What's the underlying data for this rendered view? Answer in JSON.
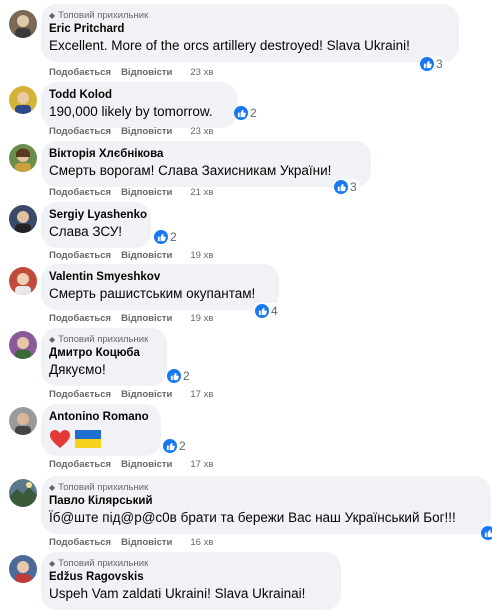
{
  "labels": {
    "top_fan": "Топовий прихильник",
    "like": "Подобається",
    "reply": "Відповісти"
  },
  "comments": [
    {
      "author": "Eric Pritchard",
      "text": "Excellent. More of the orcs artillery destroyed! Slava Ukraini!",
      "time": "23 хв",
      "reactions": "3",
      "top_fan": true,
      "avatar_color": "#7a6a55"
    },
    {
      "author": "Todd Kolod",
      "text": "190,000 likely by tomorrow.",
      "time": "23 хв",
      "reactions": "2",
      "top_fan": false,
      "avatar_color": "#d4b23a"
    },
    {
      "author": "Вікторія Хлєбнікова",
      "text": "Смерть ворогам! Слава Захисникам України!",
      "time": "21 хв",
      "reactions": "3",
      "top_fan": false,
      "avatar_color": "#6b8f4a"
    },
    {
      "author": "Sergiy Lyashenko",
      "text": "Слава ЗСУ!",
      "time": "19 хв",
      "reactions": "2",
      "top_fan": false,
      "avatar_color": "#3b4a6b"
    },
    {
      "author": "Valentin Smyeshkov",
      "text": "Смерть рашистським окупантам!",
      "time": "19 хв",
      "reactions": "4",
      "top_fan": false,
      "avatar_color": "#c24a3a"
    },
    {
      "author": "Дмитро Коцюба",
      "text": "Дякуємо!",
      "time": "17 хв",
      "reactions": "2",
      "top_fan": true,
      "avatar_color": "#8a5a9a"
    },
    {
      "author": "Antonino Romano",
      "text": "",
      "time": "17 хв",
      "reactions": "2",
      "top_fan": false,
      "avatar_color": "#9a9a9a",
      "emoji": [
        "heart",
        "ukraine-flag"
      ]
    },
    {
      "author": "Павло Кілярський",
      "text": "Їб@ште під@р@с0в брати та бережи Вас наш Український Бог!!!",
      "time": "16 хв",
      "reactions": "",
      "top_fan": true,
      "avatar_color": "#5a7a8a"
    },
    {
      "author": "Edžus Ragovskis",
      "text": "Uspeh Vam zaldati Ukraini! Slava Ukrainai!",
      "time": "",
      "reactions": "",
      "top_fan": true,
      "avatar_color": "#4a6a9a"
    }
  ]
}
